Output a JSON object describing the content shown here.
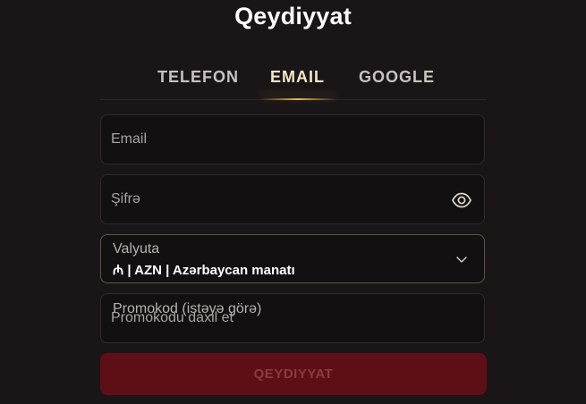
{
  "title": "Qeydiyyat",
  "tabs": [
    {
      "label": "TELEFON"
    },
    {
      "label": "EMAIL"
    },
    {
      "label": "GOOGLE"
    }
  ],
  "active_tab": "EMAIL",
  "form": {
    "email": {
      "value": "",
      "placeholder": "Email"
    },
    "password": {
      "value": "",
      "placeholder": "Şifrə",
      "toggle_icon": "eye-icon"
    },
    "currency": {
      "label": "Valyuta",
      "selected": "₼ | AZN | Azərbaycan manatı",
      "dropdown_icon": "chevron-down-icon"
    },
    "promo": {
      "label": "Promokod (istəyə görə)",
      "value": "",
      "placeholder": "Promokodu daxil et"
    },
    "submit_label": "QEYDIYYAT"
  },
  "colors": {
    "background": "#1a1617",
    "field_bg": "#131011",
    "accent_gold": "#e6b45a",
    "submit_bg": "#5e0e17",
    "submit_text": "#8a3a42"
  }
}
